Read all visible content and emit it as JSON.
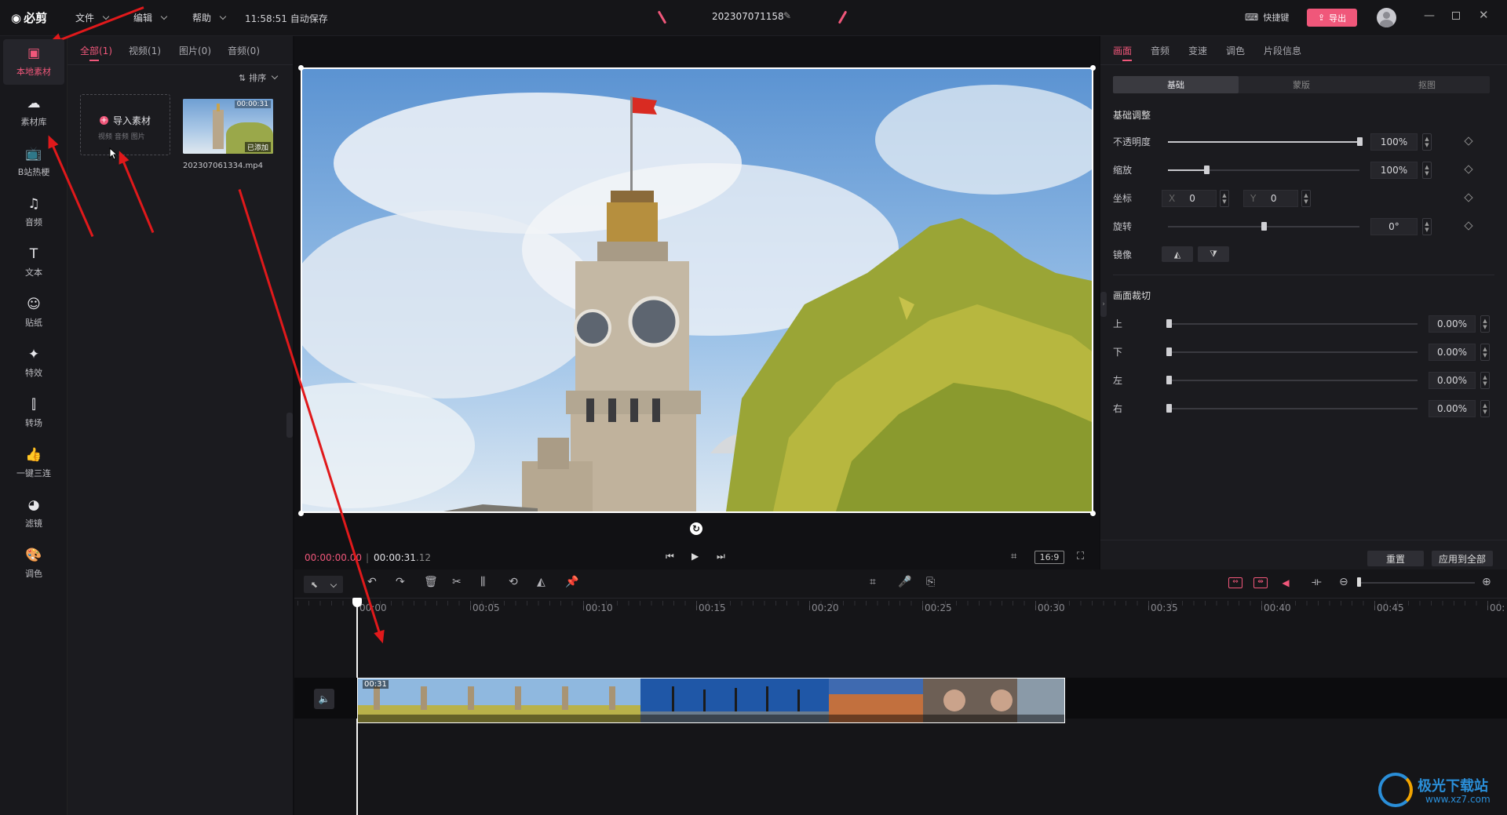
{
  "titlebar": {
    "app_name": "必剪",
    "menus": [
      "文件",
      "编辑",
      "帮助"
    ],
    "autosave": "11:58:51 自动保存",
    "project_name": "202307071158",
    "shortcuts_label": "快捷键",
    "export_label": "导出"
  },
  "tools": [
    {
      "label": "本地素材",
      "icon": "folder-icon",
      "active": true
    },
    {
      "label": "素材库",
      "icon": "cloud-library-icon"
    },
    {
      "label": "B站热梗",
      "icon": "tv-icon"
    },
    {
      "label": "音频",
      "icon": "music-note-icon"
    },
    {
      "label": "文本",
      "icon": "text-icon"
    },
    {
      "label": "贴纸",
      "icon": "sticker-icon"
    },
    {
      "label": "特效",
      "icon": "effects-icon"
    },
    {
      "label": "转场",
      "icon": "transition-icon"
    },
    {
      "label": "一键三连",
      "icon": "thumbs-up-icon"
    },
    {
      "label": "滤镜",
      "icon": "filter-icon"
    },
    {
      "label": "调色",
      "icon": "palette-icon"
    }
  ],
  "media": {
    "tabs": [
      "全部(1)",
      "视频(1)",
      "图片(0)",
      "音频(0)"
    ],
    "sort_label": "排序",
    "import_label": "导入素材",
    "import_sub": "视频 音频 图片",
    "clip_duration": "00:00:31",
    "clip_added": "已添加",
    "clip_name": "202307061334.mp4"
  },
  "player": {
    "current_time": "00:00:00.00",
    "total_time": "00:00:31",
    "total_frac": ".12",
    "aspect": "16:9"
  },
  "props": {
    "tabs": [
      "画面",
      "音频",
      "变速",
      "调色",
      "片段信息"
    ],
    "subtabs": [
      "基础",
      "蒙版",
      "抠图"
    ],
    "basic_title": "基础调整",
    "opacity_label": "不透明度",
    "opacity_value": "100%",
    "opacity_level": 1.0,
    "scale_label": "缩放",
    "scale_value": "100%",
    "scale_level": 0.2,
    "position_label": "坐标",
    "x_label": "X",
    "x_value": "0",
    "y_label": "Y",
    "y_value": "0",
    "rotate_label": "旋转",
    "rotate_value": "0°",
    "rotate_level": 0.5,
    "mirror_label": "镜像",
    "crop_title": "画面裁切",
    "crop": [
      {
        "label": "上",
        "value": "0.00%"
      },
      {
        "label": "下",
        "value": "0.00%"
      },
      {
        "label": "左",
        "value": "0.00%"
      },
      {
        "label": "右",
        "value": "0.00%"
      }
    ],
    "reset_label": "重置",
    "apply_all_label": "应用到全部"
  },
  "timeline": {
    "ticks": [
      "00:00",
      "00:05",
      "00:10",
      "00:15",
      "00:20",
      "00:25",
      "00:30",
      "00:35",
      "00:40",
      "00:45",
      "00:"
    ],
    "clip_duration": "00:31"
  },
  "watermark": {
    "name": "极光下载站",
    "url": "www.xz7.com"
  }
}
